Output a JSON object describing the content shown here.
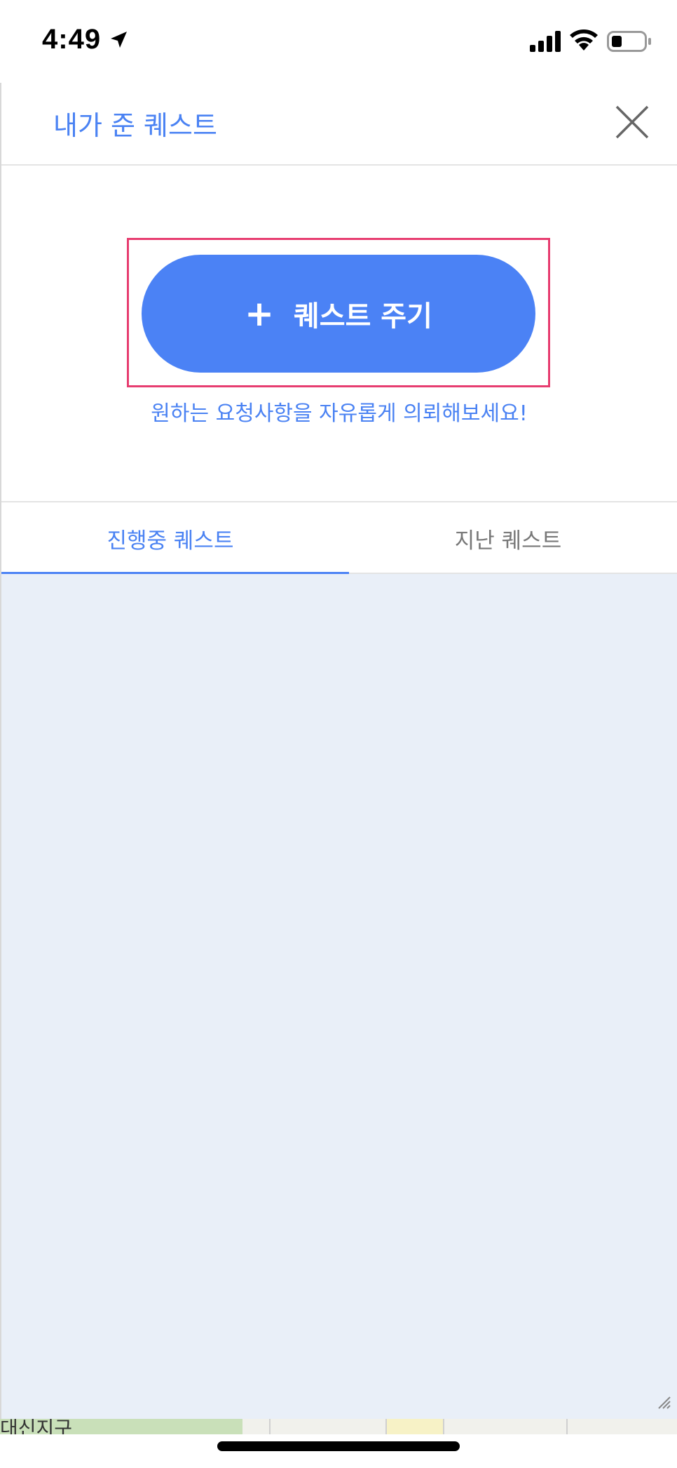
{
  "status_bar": {
    "time": "4:49"
  },
  "header": {
    "title": "내가 준 퀘스트",
    "close_icon": "close-icon"
  },
  "quest_button": {
    "plus": "+",
    "label": "퀘스트 주기"
  },
  "subtitle": "원하는 요청사항을 자유롭게 의뢰해보세요!",
  "tabs": [
    {
      "label": "진행중 퀘스트",
      "active": true
    },
    {
      "label": "지난 퀘스트",
      "active": false
    }
  ],
  "map": {
    "label": "대신지구"
  },
  "colors": {
    "accent": "#4b82f5",
    "highlight": "#e73d70",
    "content_bg": "#e9eff8"
  }
}
